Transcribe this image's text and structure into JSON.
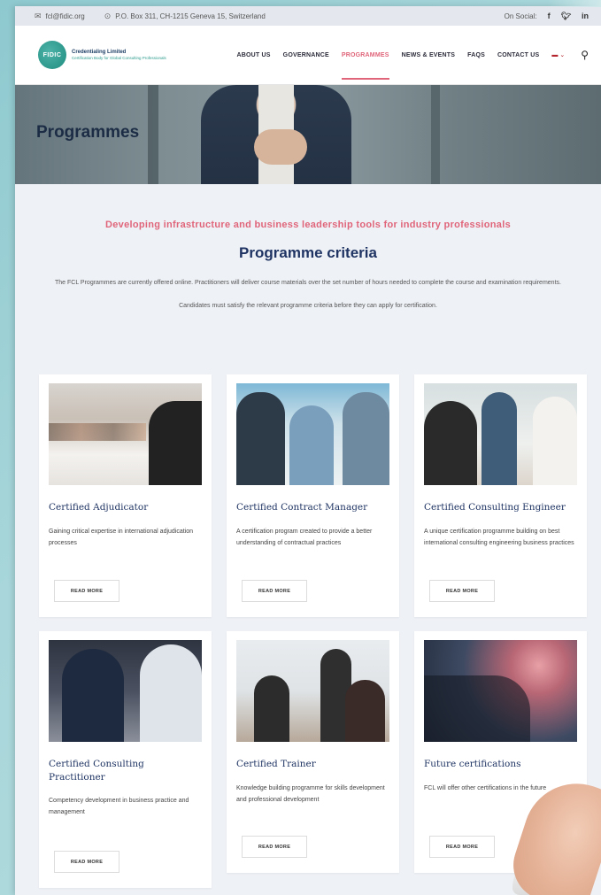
{
  "topbar": {
    "email": "fcl@fidic.org",
    "address": "P.O. Box 311, CH-1215 Geneva 15, Switzerland",
    "social_label": "On Social:",
    "social_icons": [
      "facebook-icon",
      "twitter-icon",
      "linkedin-icon"
    ]
  },
  "logo": {
    "mark": "FIDIC",
    "name": "Credentialing Limited",
    "tagline": "Certification Body for Global Consulting Professionals"
  },
  "nav": {
    "items": [
      "ABOUT US",
      "GOVERNANCE",
      "PROGRAMMES",
      "NEWS & EVENTS",
      "FAQS",
      "CONTACT US"
    ],
    "active": "PROGRAMMES",
    "active_color": "#e0657a"
  },
  "hero": {
    "title": "Programmes"
  },
  "intro": {
    "tagline": "Developing infrastructure and business leadership tools for industry professionals",
    "title": "Programme criteria",
    "description": "The FCL Programmes are currently offered online. Practitioners will deliver course materials over the set number of hours needed to complete the course and examination requirements.",
    "note": "Candidates must satisfy the relevant programme criteria before they can apply for certification."
  },
  "cards": [
    {
      "title": "Certified Adjudicator",
      "text": "Gaining critical expertise in international adjudication processes",
      "button": "READ MORE"
    },
    {
      "title": "Certified Contract Manager",
      "text": "A certification program created to provide a better understanding of contractual practices",
      "button": "READ MORE"
    },
    {
      "title": "Certified Consulting Engineer",
      "text": "A unique certification programme building on best international consulting engineering business practices",
      "button": "READ MORE"
    },
    {
      "title": "Certified Consulting Practitioner",
      "text": "Competency development in business practice and management",
      "button": "READ MORE"
    },
    {
      "title": "Certified Trainer",
      "text": "Knowledge building programme for skills development and professional development",
      "button": "READ MORE"
    },
    {
      "title": "Future certifications",
      "text": "FCL will offer other certifications in the future",
      "button": "READ MORE"
    }
  ]
}
